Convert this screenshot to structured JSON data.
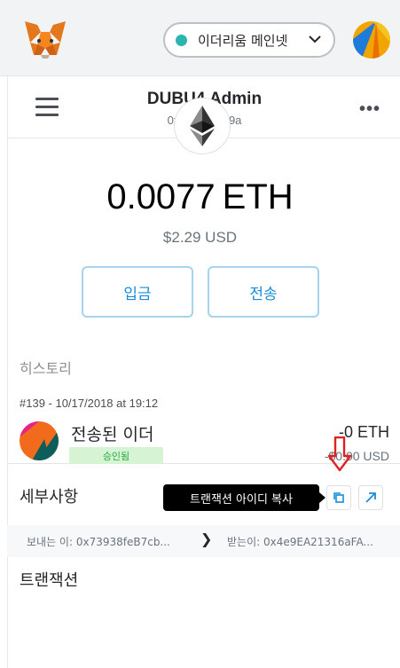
{
  "network": {
    "label": "이더리움 메인넷",
    "dot_color": "#29b6af"
  },
  "account": {
    "name": "DUBU4 Admin",
    "address_short": "0x7393...B89a"
  },
  "balance": {
    "amount": "0.0077",
    "currency": "ETH",
    "fiat": "$2.29 USD"
  },
  "actions": {
    "deposit_label": "입금",
    "send_label": "전송"
  },
  "history": {
    "label": "히스토리",
    "transactions": [
      {
        "meta": "#139 - 10/17/2018 at 19:12",
        "title": "전송된 이더",
        "status": "승인됨",
        "eth": "-0 ETH",
        "usd": "-$0.00 USD"
      }
    ]
  },
  "details": {
    "label": "세부사항",
    "copy_tooltip": "트랜잭션 아이디 복사",
    "from": "보내는 이: 0x73938feB7cb...",
    "to": "받는이: 0x4e9EA21316aFA...",
    "transaction_label": "트랜잭션"
  },
  "colors": {
    "accent": "#1a8cd8",
    "status_green": "#28a745",
    "highlight_red": "#e02020"
  }
}
